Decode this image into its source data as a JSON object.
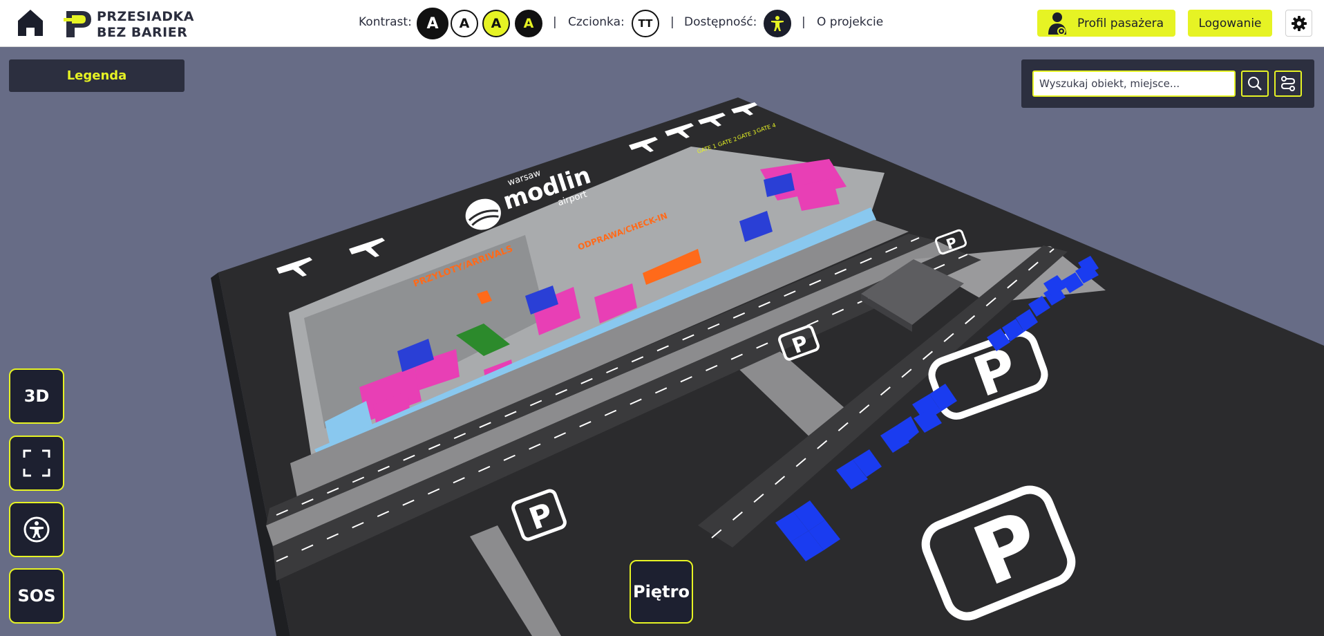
{
  "header": {
    "logo": {
      "line1": "PRZESIADKA",
      "line2": "BEZ BARIER"
    },
    "contrast_label": "Kontrast:",
    "contrast_options": [
      "A",
      "A",
      "A",
      "A"
    ],
    "font_label": "Czcionka:",
    "font_icon_text": "TT",
    "accessibility_label": "Dostępność:",
    "separator": "|",
    "about_link": "O projekcie",
    "passenger_profile": "Profil pasażera",
    "login": "Logowanie"
  },
  "map": {
    "legend": "Legenda",
    "search": {
      "placeholder": "Wyszukaj obiekt, miejsce..."
    },
    "side_buttons": {
      "view_3d": "3D",
      "sos": "SOS"
    },
    "floor_button": "Piętro",
    "airport": {
      "line1": "warsaw",
      "line2": "modlin",
      "line3": "airport"
    },
    "zone_labels": [
      "PRZYLOTY/ARRIVALS",
      "ODPRAWA/CHECK-IN",
      "GATE 1",
      "GATE 2",
      "GATE 3",
      "GATE 4"
    ]
  },
  "colors": {
    "accent": "#e6f324",
    "dark_panel": "#2c2f3f",
    "background": "#676c86",
    "terminal_pink": "#e83fb5",
    "terminal_blue": "#2a3fd6",
    "terminal_light_blue": "#89c8ef",
    "orange": "#ff6a1a",
    "disabled_parking": "#1a3cf0"
  }
}
